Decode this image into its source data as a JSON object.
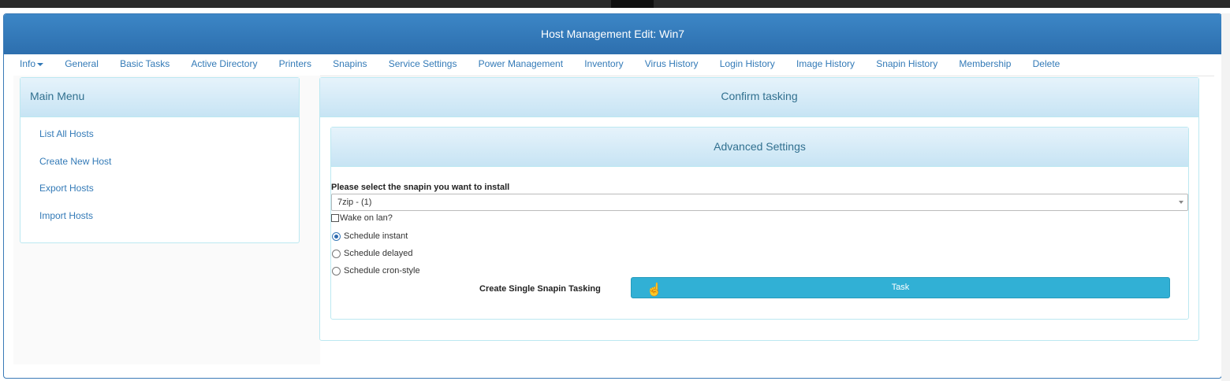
{
  "header": {
    "title": "Host Management Edit: Win7"
  },
  "nav": {
    "items": [
      {
        "label": "Info"
      },
      {
        "label": "General"
      },
      {
        "label": "Basic Tasks"
      },
      {
        "label": "Active Directory"
      },
      {
        "label": "Printers"
      },
      {
        "label": "Snapins"
      },
      {
        "label": "Service Settings"
      },
      {
        "label": "Power Management"
      },
      {
        "label": "Inventory"
      },
      {
        "label": "Virus History"
      },
      {
        "label": "Login History"
      },
      {
        "label": "Image History"
      },
      {
        "label": "Snapin History"
      },
      {
        "label": "Membership"
      },
      {
        "label": "Delete"
      }
    ]
  },
  "main_menu": {
    "title": "Main Menu",
    "items": [
      {
        "label": "List All Hosts"
      },
      {
        "label": "Create New Host"
      },
      {
        "label": "Export Hosts"
      },
      {
        "label": "Import Hosts"
      }
    ]
  },
  "confirm": {
    "title": "Confirm tasking",
    "advanced": {
      "title": "Advanced Settings",
      "snapin_label": "Please select the snapin you want to install",
      "snapin_selected": "7zip - (1)",
      "wake_on_lan_label": "Wake on lan?",
      "wake_on_lan_checked": false,
      "schedule_options": [
        {
          "label": "Schedule instant",
          "checked": true
        },
        {
          "label": "Schedule delayed",
          "checked": false
        },
        {
          "label": "Schedule cron-style",
          "checked": false
        }
      ],
      "task_label": "Create Single Snapin Tasking",
      "task_button": "Task"
    }
  },
  "colors": {
    "header": "#2d6fae",
    "link": "#337ab7",
    "button": "#31b0d5"
  }
}
